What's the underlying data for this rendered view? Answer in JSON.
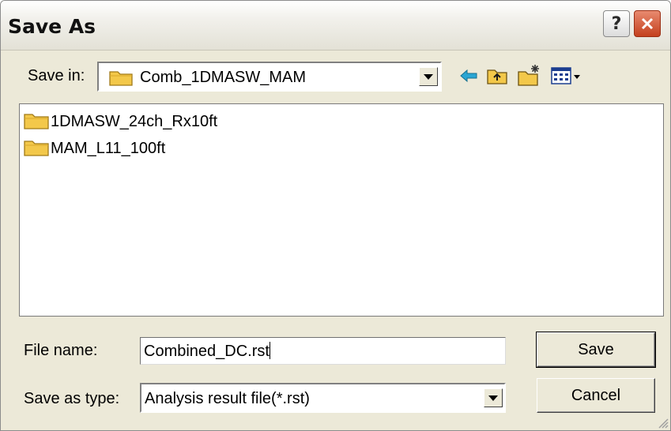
{
  "window": {
    "title": "Save As",
    "help_glyph": "?",
    "help_icon": "question-mark-icon",
    "close_icon": "close-x-icon"
  },
  "save_in": {
    "label": "Save in:",
    "value": "Comb_1DMASW_MAM",
    "icon": "folder-icon"
  },
  "toolbar": {
    "back_icon": "back-arrow-icon",
    "up_icon": "up-one-level-icon",
    "new_folder_icon": "new-folder-icon",
    "view_icon": "view-menu-icon"
  },
  "file_list": {
    "items": [
      {
        "name": "1DMASW_24ch_Rx10ft",
        "icon": "folder-icon"
      },
      {
        "name": "MAM_L11_100ft",
        "icon": "folder-icon"
      }
    ]
  },
  "file_name": {
    "label": "File name:",
    "value": "Combined_DC.rst"
  },
  "save_as_type": {
    "label": "Save as type:",
    "value": "Analysis result file(*.rst)"
  },
  "buttons": {
    "save": "Save",
    "cancel": "Cancel"
  },
  "colors": {
    "dialog_background": "#ece9d8",
    "close_button": "#c4401e",
    "folder_yellow": "#f3c84a",
    "back_arrow": "#2aa6d4"
  }
}
